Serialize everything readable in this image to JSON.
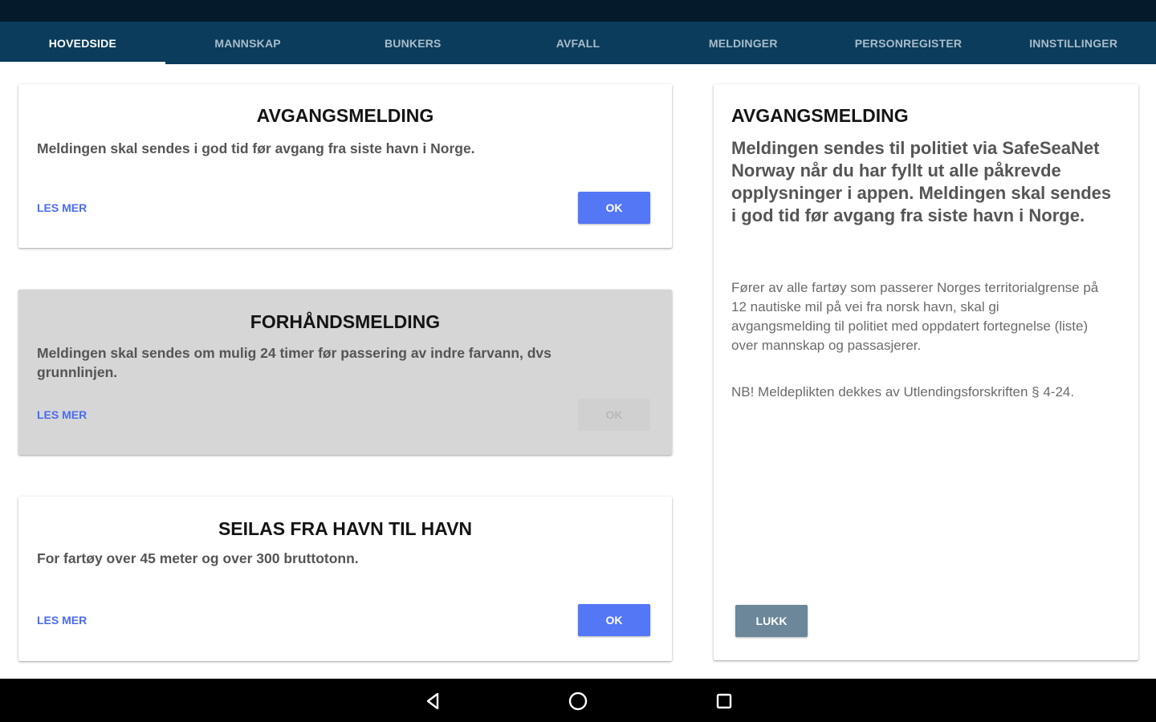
{
  "tabs": [
    {
      "label": "HOVEDSIDE",
      "active": true
    },
    {
      "label": "MANNSKAP",
      "active": false
    },
    {
      "label": "BUNKERS",
      "active": false
    },
    {
      "label": "AVFALL",
      "active": false
    },
    {
      "label": "MELDINGER",
      "active": false
    },
    {
      "label": "PERSONREGISTER",
      "active": false
    },
    {
      "label": "INNSTILLINGER",
      "active": false
    }
  ],
  "cards": [
    {
      "title": "AVGANGSMELDING",
      "description": "Meldingen skal sendes i god tid før avgang fra siste havn i Norge.",
      "link_label": "LES MER",
      "ok_label": "OK",
      "enabled": true
    },
    {
      "title": "FORHÅNDSMELDING",
      "description": "Meldingen skal sendes om mulig 24 timer før passering av indre farvann, dvs grunnlinjen.",
      "link_label": "LES MER",
      "ok_label": "OK",
      "enabled": false
    },
    {
      "title": "SEILAS FRA HAVN TIL HAVN",
      "description": "For fartøy over 45 meter og over 300 bruttotonn.",
      "link_label": "LES MER",
      "ok_label": "OK",
      "enabled": true
    }
  ],
  "info_panel": {
    "title": "AVGANGSMELDING",
    "lead": "Meldingen sendes til politiet via SafeSeaNet Norway når du har fyllt ut alle påkrevde opplysninger i appen. Meldingen skal sendes i god tid før avgang fra siste havn i Norge.",
    "body": "Fører av alle fartøy som passerer Norges territorialgrense på 12 nautiske mil på vei fra norsk havn, skal gi avgangsmelding til politiet med oppdatert fortegnelse (liste) over mannskap og passasjerer.",
    "note": "NB! Meldeplikten dekkes av Utlendingsforskriften § 4-24.",
    "close_label": "LUKK"
  },
  "navbar": {
    "icons": [
      "back-icon",
      "home-icon",
      "recents-icon"
    ]
  },
  "colors": {
    "tabbar": "#0b3c5b",
    "status_bar": "#051a2a",
    "primary_button": "#5477f5",
    "link": "#4a6cf0",
    "close_button": "#6b8799",
    "disabled_card": "#d6d6d6"
  }
}
